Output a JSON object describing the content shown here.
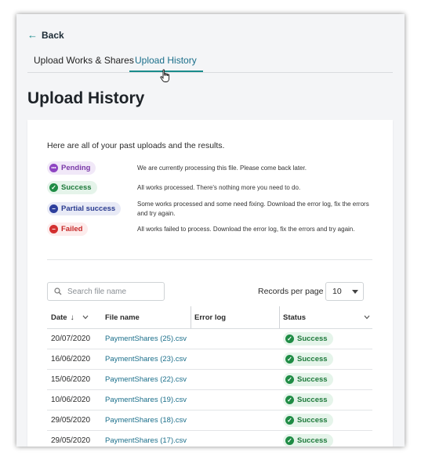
{
  "nav": {
    "back_label": "Back"
  },
  "tabs": [
    {
      "label": "Upload Works & Shares",
      "active": false
    },
    {
      "label": "Upload History",
      "active": true
    }
  ],
  "page_title": "Upload History",
  "intro": "Here are all of your past uploads and the results.",
  "legend": [
    {
      "label": "Pending",
      "icon": "ellipsis-icon",
      "glyph": "•••",
      "description": "We are currently processing this file. Please come back later."
    },
    {
      "label": "Success",
      "icon": "check-icon",
      "glyph": "✓",
      "description": "All works processed. There's nothing more you need to do."
    },
    {
      "label": "Partial success",
      "icon": "minus-icon",
      "glyph": "−",
      "description": "Some works processed and some need fixing. Download the error log, fix the errors and try again."
    },
    {
      "label": "Failed",
      "icon": "minus-icon",
      "glyph": "−",
      "description": "All works failed to process. Download the error log, fix the errors and try again."
    }
  ],
  "search": {
    "placeholder": "Search file name",
    "value": ""
  },
  "records": {
    "label": "Records per page",
    "value": "10"
  },
  "table": {
    "columns": [
      "Date",
      "File name",
      "Error log",
      "Status"
    ],
    "rows": [
      {
        "date": "20/07/2020",
        "file": "PaymentShares (25).csv",
        "error_log": "",
        "status": "Success"
      },
      {
        "date": "16/06/2020",
        "file": "PaymentShares (23).csv",
        "error_log": "",
        "status": "Success"
      },
      {
        "date": "15/06/2020",
        "file": "PaymentShares (22).csv",
        "error_log": "",
        "status": "Success"
      },
      {
        "date": "10/06/2020",
        "file": "PaymentShares (19).csv",
        "error_log": "",
        "status": "Success"
      },
      {
        "date": "29/05/2020",
        "file": "PaymentShares (18).csv",
        "error_log": "",
        "status": "Success"
      },
      {
        "date": "29/05/2020",
        "file": "PaymentShares (17).csv",
        "error_log": "",
        "status": "Success"
      }
    ]
  },
  "colors": {
    "accent": "#1a8c8c",
    "success": "#1f8c45",
    "pending": "#8e44c2",
    "partial": "#2d3e9c",
    "failed": "#d32f2f"
  }
}
